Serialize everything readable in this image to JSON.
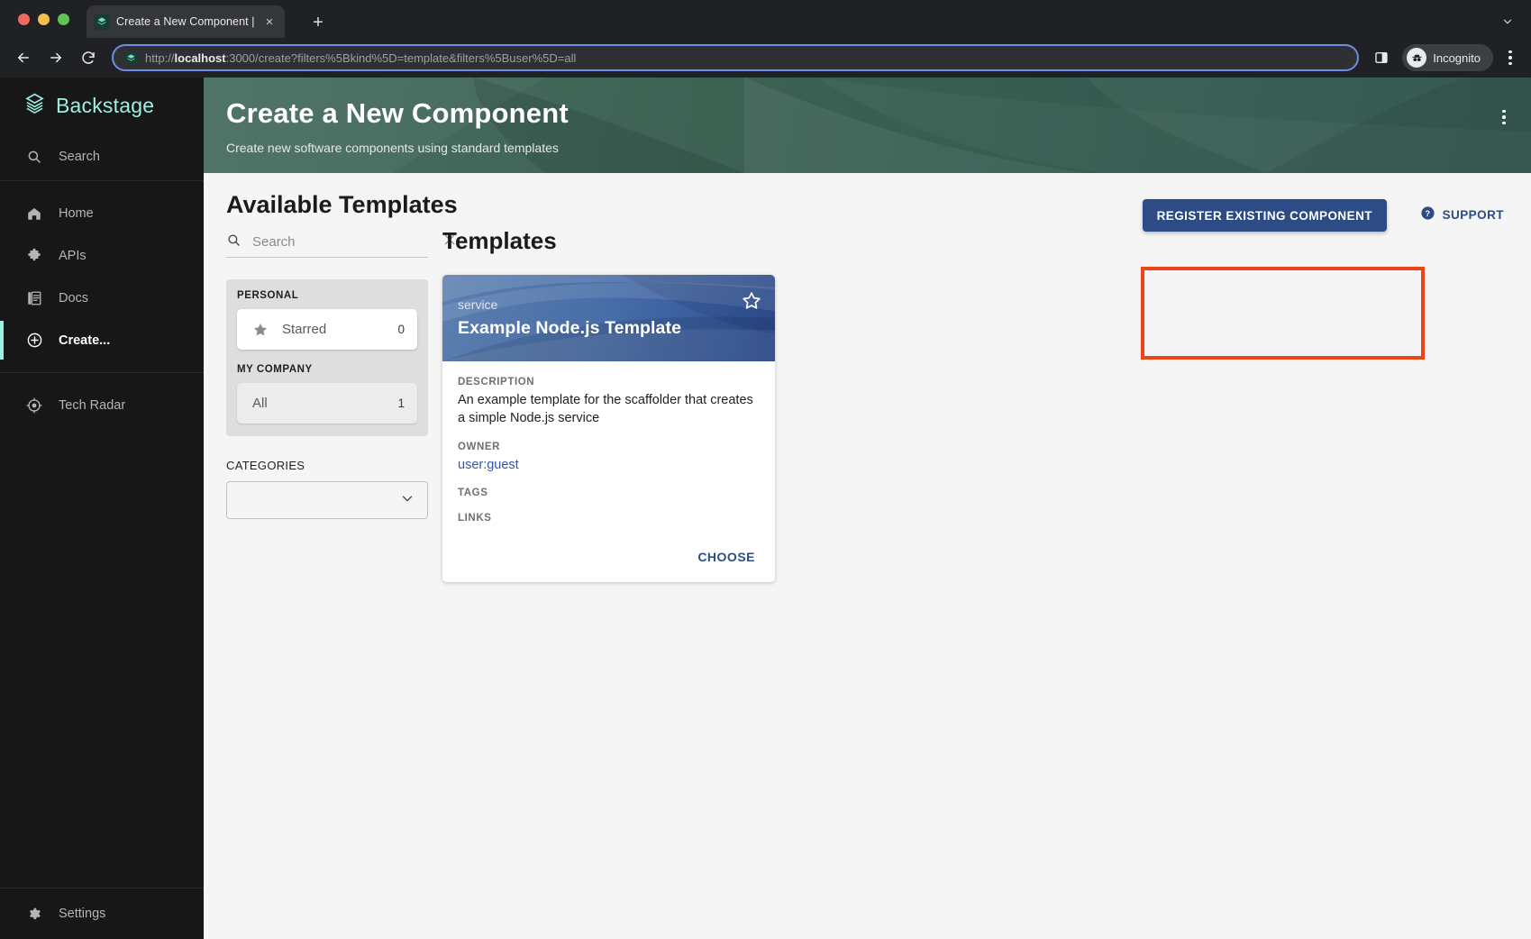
{
  "browser": {
    "tab": {
      "title": "Create a New Component | Tem",
      "favicon": "backstage-favicon",
      "close": "×"
    },
    "new_tab_label": "+",
    "toolbar": {
      "back": "←",
      "forward": "→",
      "reload": "⟳",
      "url_scheme": "http://",
      "url_host": "localhost",
      "url_rest": ":3000/create?filters%5Bkind%5D=template&filters%5Buser%5D=all",
      "profile_label": "Incognito"
    }
  },
  "sidebar": {
    "brand": "Backstage",
    "search_label": "Search",
    "items": [
      {
        "label": "Home",
        "icon": "home-icon"
      },
      {
        "label": "APIs",
        "icon": "puzzle-icon"
      },
      {
        "label": "Docs",
        "icon": "docs-icon"
      },
      {
        "label": "Create...",
        "icon": "plus-circle-icon"
      },
      {
        "label": "Tech Radar",
        "icon": "radar-icon"
      }
    ],
    "settings_label": "Settings"
  },
  "header": {
    "title": "Create a New Component",
    "subtitle": "Create new software components using standard templates",
    "menu_icon": "kebab-menu-icon"
  },
  "main": {
    "page_title": "Available Templates",
    "register_button": "REGISTER EXISTING COMPONENT",
    "support_label": "SUPPORT",
    "templates_heading": "Templates"
  },
  "filters": {
    "search_placeholder": "Search",
    "search_value": "",
    "clear_icon": "close-icon",
    "groups": [
      {
        "label": "PERSONAL",
        "options": [
          {
            "label": "Starred",
            "count": "0",
            "icon": "star-filled-icon",
            "selected": false
          }
        ]
      },
      {
        "label": "MY COMPANY",
        "options": [
          {
            "label": "All",
            "count": "1",
            "icon": "",
            "selected": true
          }
        ]
      }
    ],
    "categories_label": "CATEGORIES",
    "categories_value": "",
    "categories_chevron": "chevron-down-icon"
  },
  "template_card": {
    "kind": "service",
    "title": "Example Node.js Template",
    "star_icon": "star-outline-icon",
    "fields": [
      {
        "label": "DESCRIPTION",
        "value": "An example template for the scaffolder that creates a simple Node.js service"
      },
      {
        "label": "OWNER",
        "value": "user:guest",
        "is_link": true
      },
      {
        "label": "TAGS",
        "value": ""
      },
      {
        "label": "LINKS",
        "value": ""
      }
    ],
    "choose_label": "CHOOSE"
  },
  "annotation": {
    "color": "#ee4417",
    "target": "register-existing-component-button"
  },
  "colors": {
    "brand_teal": "#9BF0E1",
    "header_green": "#3d6254",
    "primary_blue": "#2d4b84",
    "card_blue": "#2e4f97",
    "annotation_red": "#ee4417"
  }
}
